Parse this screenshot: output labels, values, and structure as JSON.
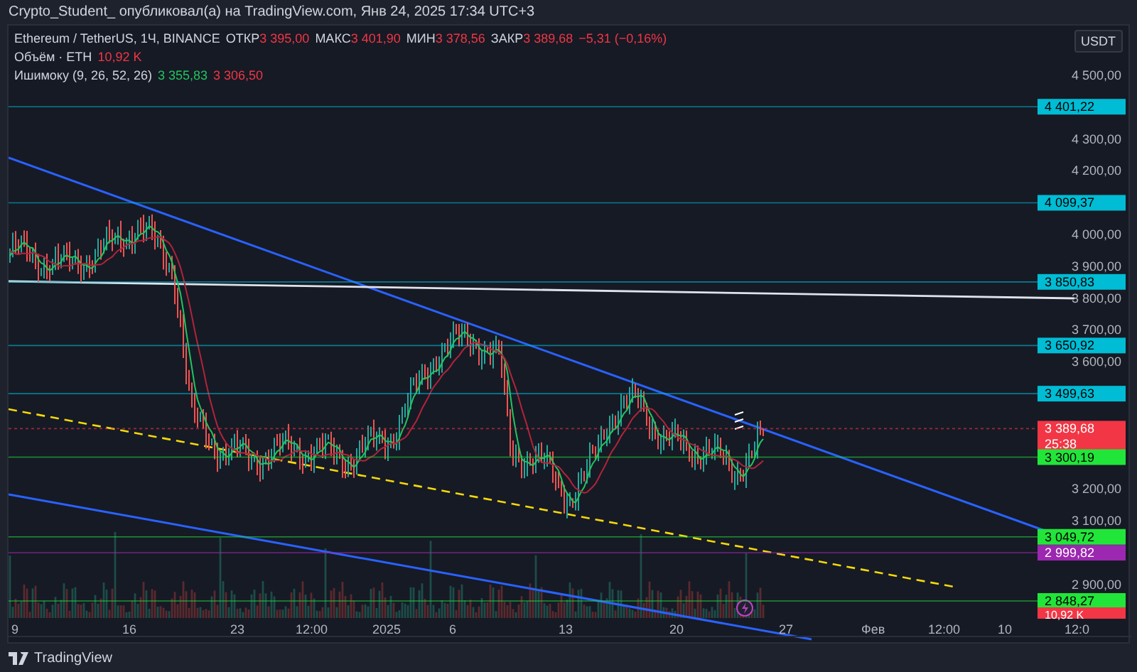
{
  "publish_line": "Crypto_Student_ опубликовал(а) на TradingView.com, Янв 24, 2025 17:34 UTC+3",
  "legend": {
    "symbol": "Ethereum / TetherUS, 1Ч, BINANCE",
    "ohlc": [
      {
        "label": "ОТКР",
        "value": "3 395,00"
      },
      {
        "label": "МАКС",
        "value": "3 401,90"
      },
      {
        "label": "МИН",
        "value": "3 378,56"
      },
      {
        "label": "ЗАКР",
        "value": "3 389,68"
      }
    ],
    "change": "−5,31 (−0,16%)",
    "volume_label": "Объём · ETH",
    "volume_value": "10,92 K",
    "indicator_label": "Ишимоку (9, 26, 52, 26)",
    "indicator_values": [
      {
        "value": "3 355,83",
        "color": "#22c55e"
      },
      {
        "value": "3 306,50",
        "color": "#f23645"
      }
    ]
  },
  "currency": "USDT",
  "price_ticks": [
    "4 500,00",
    "4 300,00",
    "4 200,00",
    "4 000,00",
    "3 900,00",
    "3 800,00",
    "3 700,00",
    "3 600,00",
    "3 200,00",
    "3 100,00",
    "2 900,00"
  ],
  "price_badges": [
    {
      "kind": "price",
      "label": "4 401,22",
      "color": "#00bcd4"
    },
    {
      "kind": "price",
      "label": "4 099,37",
      "color": "#00bcd4"
    },
    {
      "kind": "price",
      "label": "3 850,83",
      "color": "#00bcd4"
    },
    {
      "kind": "price",
      "label": "3 650,92",
      "color": "#00bcd4"
    },
    {
      "kind": "price",
      "label": "3 499,63",
      "color": "#00bcd4"
    },
    {
      "kind": "price",
      "label": "3 389,68",
      "color": "#f23645",
      "countdown": "25:38"
    },
    {
      "kind": "price",
      "label": "3 300,19",
      "color": "#22e53a"
    },
    {
      "kind": "price",
      "label": "3 049,72",
      "color": "#22e53a"
    },
    {
      "kind": "price",
      "label": "2 999,82",
      "color": "#9c27b0"
    },
    {
      "kind": "price",
      "label": "2 848,27",
      "color": "#22e53a"
    },
    {
      "kind": "volume",
      "label": "10,92 K",
      "color": "#f23645"
    }
  ],
  "time_labels": [
    "9",
    "16",
    "23",
    "12:00",
    "2025",
    "6",
    "13",
    "20",
    "27",
    "Фев",
    "12:00",
    "10",
    "12:0"
  ],
  "brand": "TradingView"
}
